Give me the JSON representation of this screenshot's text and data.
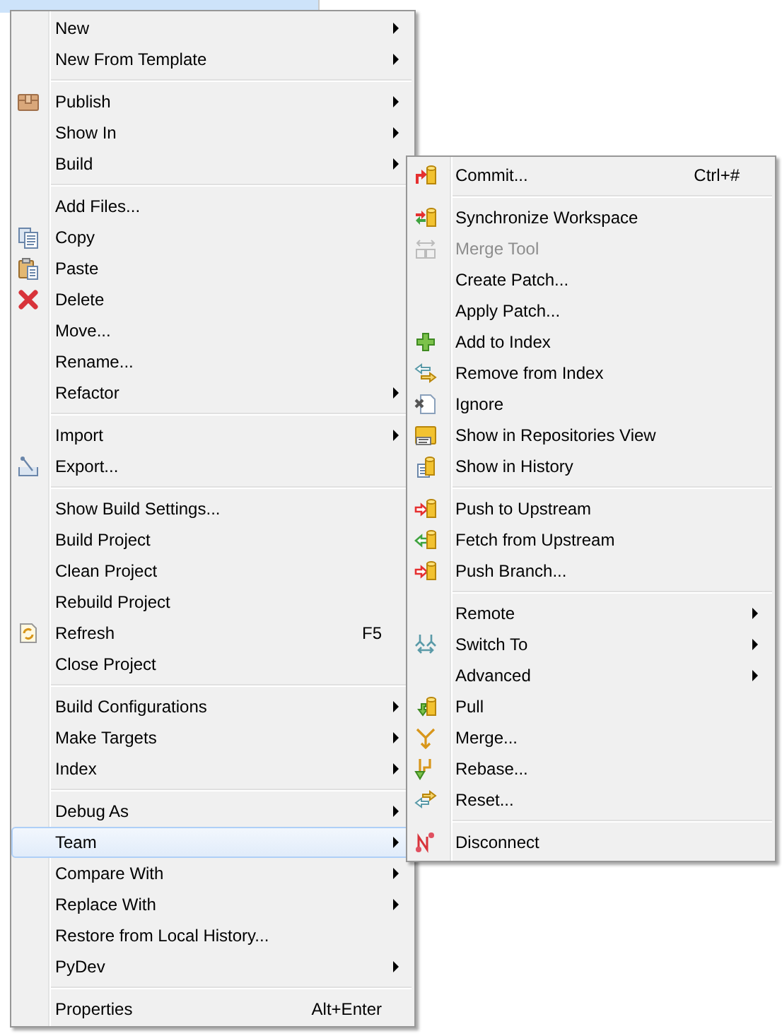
{
  "main_menu": {
    "groups": [
      {
        "items": [
          {
            "label": "New",
            "submenu": true,
            "selected": false
          },
          {
            "label": "New From Template",
            "submenu": true,
            "selected": false
          }
        ]
      },
      {
        "items": [
          {
            "label": "Publish",
            "kind": "package",
            "submenu": true,
            "selected": false
          },
          {
            "label": "Show In",
            "submenu": true,
            "selected": false
          },
          {
            "label": "Build",
            "submenu": true,
            "selected": false
          }
        ]
      },
      {
        "items": [
          {
            "label": "Add Files...",
            "submenu": false,
            "selected": false
          },
          {
            "label": "Copy",
            "kind": "copy",
            "submenu": false,
            "selected": false
          },
          {
            "label": "Paste",
            "kind": "paste",
            "submenu": false,
            "selected": false
          },
          {
            "label": "Delete",
            "kind": "delete",
            "submenu": false,
            "selected": false
          },
          {
            "label": "Move...",
            "submenu": false,
            "selected": false
          },
          {
            "label": "Rename...",
            "submenu": false,
            "selected": false
          },
          {
            "label": "Refactor",
            "submenu": true,
            "selected": false
          }
        ]
      },
      {
        "items": [
          {
            "label": "Import",
            "submenu": true,
            "selected": false
          },
          {
            "label": "Export...",
            "kind": "export",
            "submenu": false,
            "selected": false
          }
        ]
      },
      {
        "items": [
          {
            "label": "Show Build Settings...",
            "submenu": false,
            "selected": false
          },
          {
            "label": "Build Project",
            "submenu": false,
            "selected": false
          },
          {
            "label": "Clean Project",
            "submenu": false,
            "selected": false
          },
          {
            "label": "Rebuild Project",
            "submenu": false,
            "selected": false
          },
          {
            "label": "Refresh",
            "kind": "refresh",
            "shortcut": "F5",
            "submenu": false,
            "selected": false
          },
          {
            "label": "Close Project",
            "submenu": false,
            "selected": false
          }
        ]
      },
      {
        "items": [
          {
            "label": "Build Configurations",
            "submenu": true,
            "selected": false
          },
          {
            "label": "Make Targets",
            "submenu": true,
            "selected": false
          },
          {
            "label": "Index",
            "submenu": true,
            "selected": false
          }
        ]
      },
      {
        "items": [
          {
            "label": "Debug As",
            "submenu": true,
            "selected": false
          },
          {
            "label": "Team",
            "submenu": true,
            "selected": true
          },
          {
            "label": "Compare With",
            "submenu": true,
            "selected": false
          },
          {
            "label": "Replace With",
            "submenu": true,
            "selected": false
          },
          {
            "label": "Restore from Local History...",
            "submenu": false,
            "selected": false
          },
          {
            "label": "PyDev",
            "submenu": true,
            "selected": false
          }
        ]
      },
      {
        "items": [
          {
            "label": "Properties",
            "shortcut": "Alt+Enter",
            "submenu": false,
            "selected": false
          }
        ]
      }
    ]
  },
  "team_submenu": {
    "groups": [
      {
        "items": [
          {
            "label": "Commit...",
            "kind": "commit",
            "shortcut": "Ctrl+#",
            "submenu": false,
            "disabled": false
          }
        ]
      },
      {
        "items": [
          {
            "label": "Synchronize Workspace",
            "kind": "sync",
            "submenu": false,
            "disabled": false
          },
          {
            "label": "Merge Tool",
            "kind": "merge_tool",
            "submenu": false,
            "disabled": true
          },
          {
            "label": "Create Patch...",
            "submenu": false,
            "disabled": false
          },
          {
            "label": "Apply Patch...",
            "submenu": false,
            "disabled": false
          },
          {
            "label": "Add to Index",
            "kind": "add",
            "submenu": false,
            "disabled": false
          },
          {
            "label": "Remove from Index",
            "kind": "remove",
            "submenu": false,
            "disabled": false
          },
          {
            "label": "Ignore",
            "kind": "ignore",
            "submenu": false,
            "disabled": false
          },
          {
            "label": "Show in Repositories View",
            "kind": "repo",
            "submenu": false,
            "disabled": false
          },
          {
            "label": "Show in History",
            "kind": "history",
            "submenu": false,
            "disabled": false
          }
        ]
      },
      {
        "items": [
          {
            "label": "Push to Upstream",
            "kind": "push",
            "submenu": false,
            "disabled": false
          },
          {
            "label": "Fetch from Upstream",
            "kind": "fetch",
            "submenu": false,
            "disabled": false
          },
          {
            "label": "Push Branch...",
            "kind": "push",
            "submenu": false,
            "disabled": false
          }
        ]
      },
      {
        "items": [
          {
            "label": "Remote",
            "submenu": true,
            "disabled": false
          },
          {
            "label": "Switch To",
            "kind": "switch",
            "submenu": true,
            "disabled": false
          },
          {
            "label": "Advanced",
            "submenu": true,
            "disabled": false
          },
          {
            "label": "Pull",
            "kind": "pull",
            "submenu": false,
            "disabled": false
          },
          {
            "label": "Merge...",
            "kind": "merge",
            "submenu": false,
            "disabled": false
          },
          {
            "label": "Rebase...",
            "kind": "rebase",
            "submenu": false,
            "disabled": false
          },
          {
            "label": "Reset...",
            "kind": "reset",
            "submenu": false,
            "disabled": false
          }
        ]
      },
      {
        "items": [
          {
            "label": "Disconnect",
            "kind": "disconnect",
            "submenu": false,
            "disabled": false
          }
        ]
      }
    ]
  }
}
